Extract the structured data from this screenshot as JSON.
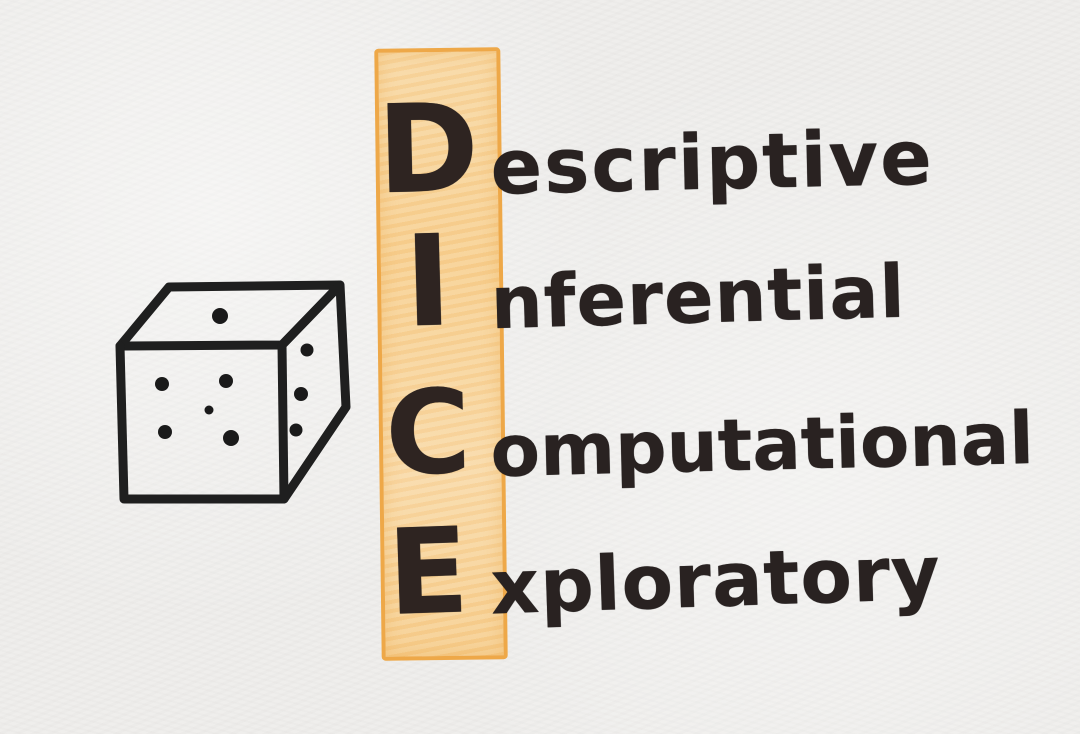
{
  "diagram": {
    "rows": [
      {
        "initial": "D",
        "rest": "escriptive"
      },
      {
        "initial": "I",
        "rest": "nferential"
      },
      {
        "initial": "C",
        "rest": "omputational"
      },
      {
        "initial": "E",
        "rest": "xploratory"
      }
    ],
    "highlight_color": "#f6cf91",
    "highlight_border_color": "#eea848",
    "ink_color": "#292221",
    "dice": {
      "front_face_pips": 5,
      "side_face_pips": 3,
      "top_face_pips": 1,
      "icon": "dice-icon"
    }
  }
}
